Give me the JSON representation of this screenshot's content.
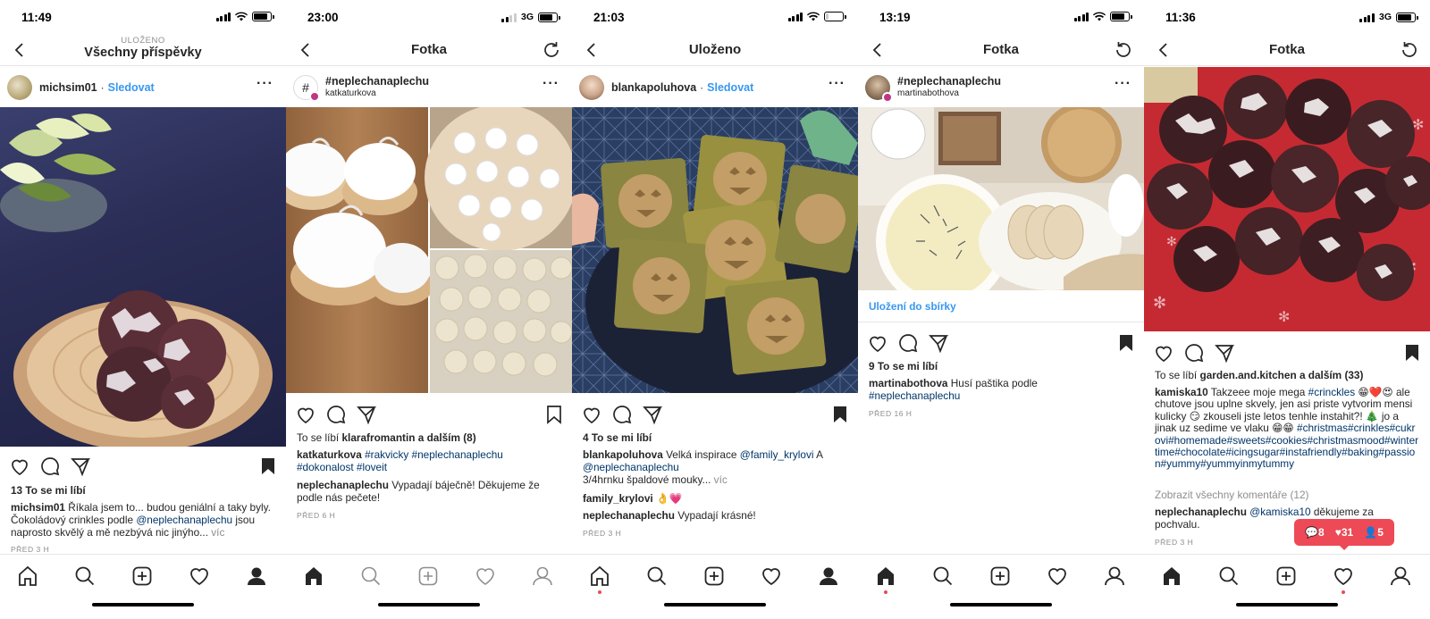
{
  "screens": [
    {
      "status_time": "11:49",
      "nav": {
        "supertitle": "ULOŽENO",
        "title": "Všechny příspěvky"
      },
      "post": {
        "username": "michsim01",
        "follow": "Sledovat"
      },
      "likes": "13 To se mi líbí",
      "caption_user": "michsim01",
      "caption_text_1": "Říkala jsem to... budou geniální a taky byly. Čokoládový crinkles podle",
      "caption_mention": "@neplechanaplechu",
      "caption_text_2": "jsou naprosto skvělý a mě nezbývá nic jinýho...",
      "caption_more": "víc",
      "timestamp": "PŘED 3 H"
    },
    {
      "status_time": "23:00",
      "carrier": "3G",
      "nav": {
        "title": "Fotka"
      },
      "post": {
        "username": "#neplechanaplechu",
        "subtitle": "katkaturkova"
      },
      "likes_prefix": "To se líbí",
      "likes_user": "klarafromantin",
      "likes_suffix": "a dalším (8)",
      "caption_user": "katkaturkova",
      "caption_tags": "#rakvicky #neplechanaplechu #dokonalost #loveit",
      "comment_user": "neplechanaplechu",
      "comment_text": "Vypadají báječně! Děkujeme že podle nás pečete!",
      "timestamp": "PŘED 6 H"
    },
    {
      "status_time": "21:03",
      "nav": {
        "title": "Uloženo"
      },
      "post": {
        "username": "blankapoluhova",
        "follow": "Sledovat"
      },
      "likes": "4 To se mi líbí",
      "caption_user": "blankapoluhova",
      "caption_text_1": "Velká inspirace",
      "caption_mention_1": "@family_krylovi",
      "caption_text_2": "A",
      "caption_mention_2": "@neplechanaplechu",
      "caption_text_3": "3/4hrnku špaldové mouky...",
      "caption_more": "víc",
      "comment1_user": "family_krylovi",
      "comment1_text": "👌💗",
      "comment2_user": "neplechanaplechu",
      "comment2_text": "Vypadají krásné!",
      "timestamp": "PŘED 3 H"
    },
    {
      "status_time": "13:19",
      "nav": {
        "title": "Fotka"
      },
      "post": {
        "username": "#neplechanaplechu",
        "subtitle": "martinabothova"
      },
      "save_to_collection": "Uložení do sbírky",
      "likes": "9 To se mi líbí",
      "caption_user": "martinabothova",
      "caption_text": "Husí paštika podle",
      "caption_tag": "#neplechanaplechu",
      "timestamp": "PŘED 16 H"
    },
    {
      "status_time": "11:36",
      "carrier": "3G",
      "nav": {
        "title": "Fotka"
      },
      "likes_prefix": "To se líbí",
      "likes_user": "garden.and.kitchen",
      "likes_suffix": "a dalším (33)",
      "caption_user": "kamiska10",
      "caption_text_1": "Takzeee moje mega",
      "caption_tag": "#crinckles",
      "caption_emojis": "😁❤️😍",
      "caption_text_2": "ale chutove jsou uplne skvely, jen asi priste vytvorim mensi kulicky 😏 zkouseli jste letos tenhle instahit?! 🎄 jo a jinak uz sedime ve vlaku 😁😁",
      "caption_tags": "#christmas#crinkles#cukrovi#homemade#sweets#cookies#christmasmood#wintertime#chocolate#icingsugar#instafriendly#baking#passion#yummy#yummyinmytummy",
      "view_all_comments": "Zobrazit všechny komentáře (12)",
      "comment_user": "neplechanaplechu",
      "comment_mention": "@kamiska10",
      "comment_text": "děkujeme za pochvalu.",
      "timestamp": "PŘED 3 H",
      "notif_comments": "8",
      "notif_likes": "31",
      "notif_follows": "5"
    }
  ],
  "colors": {
    "link": "#3897f0",
    "tag": "#003569",
    "notif": "#ed4956"
  }
}
